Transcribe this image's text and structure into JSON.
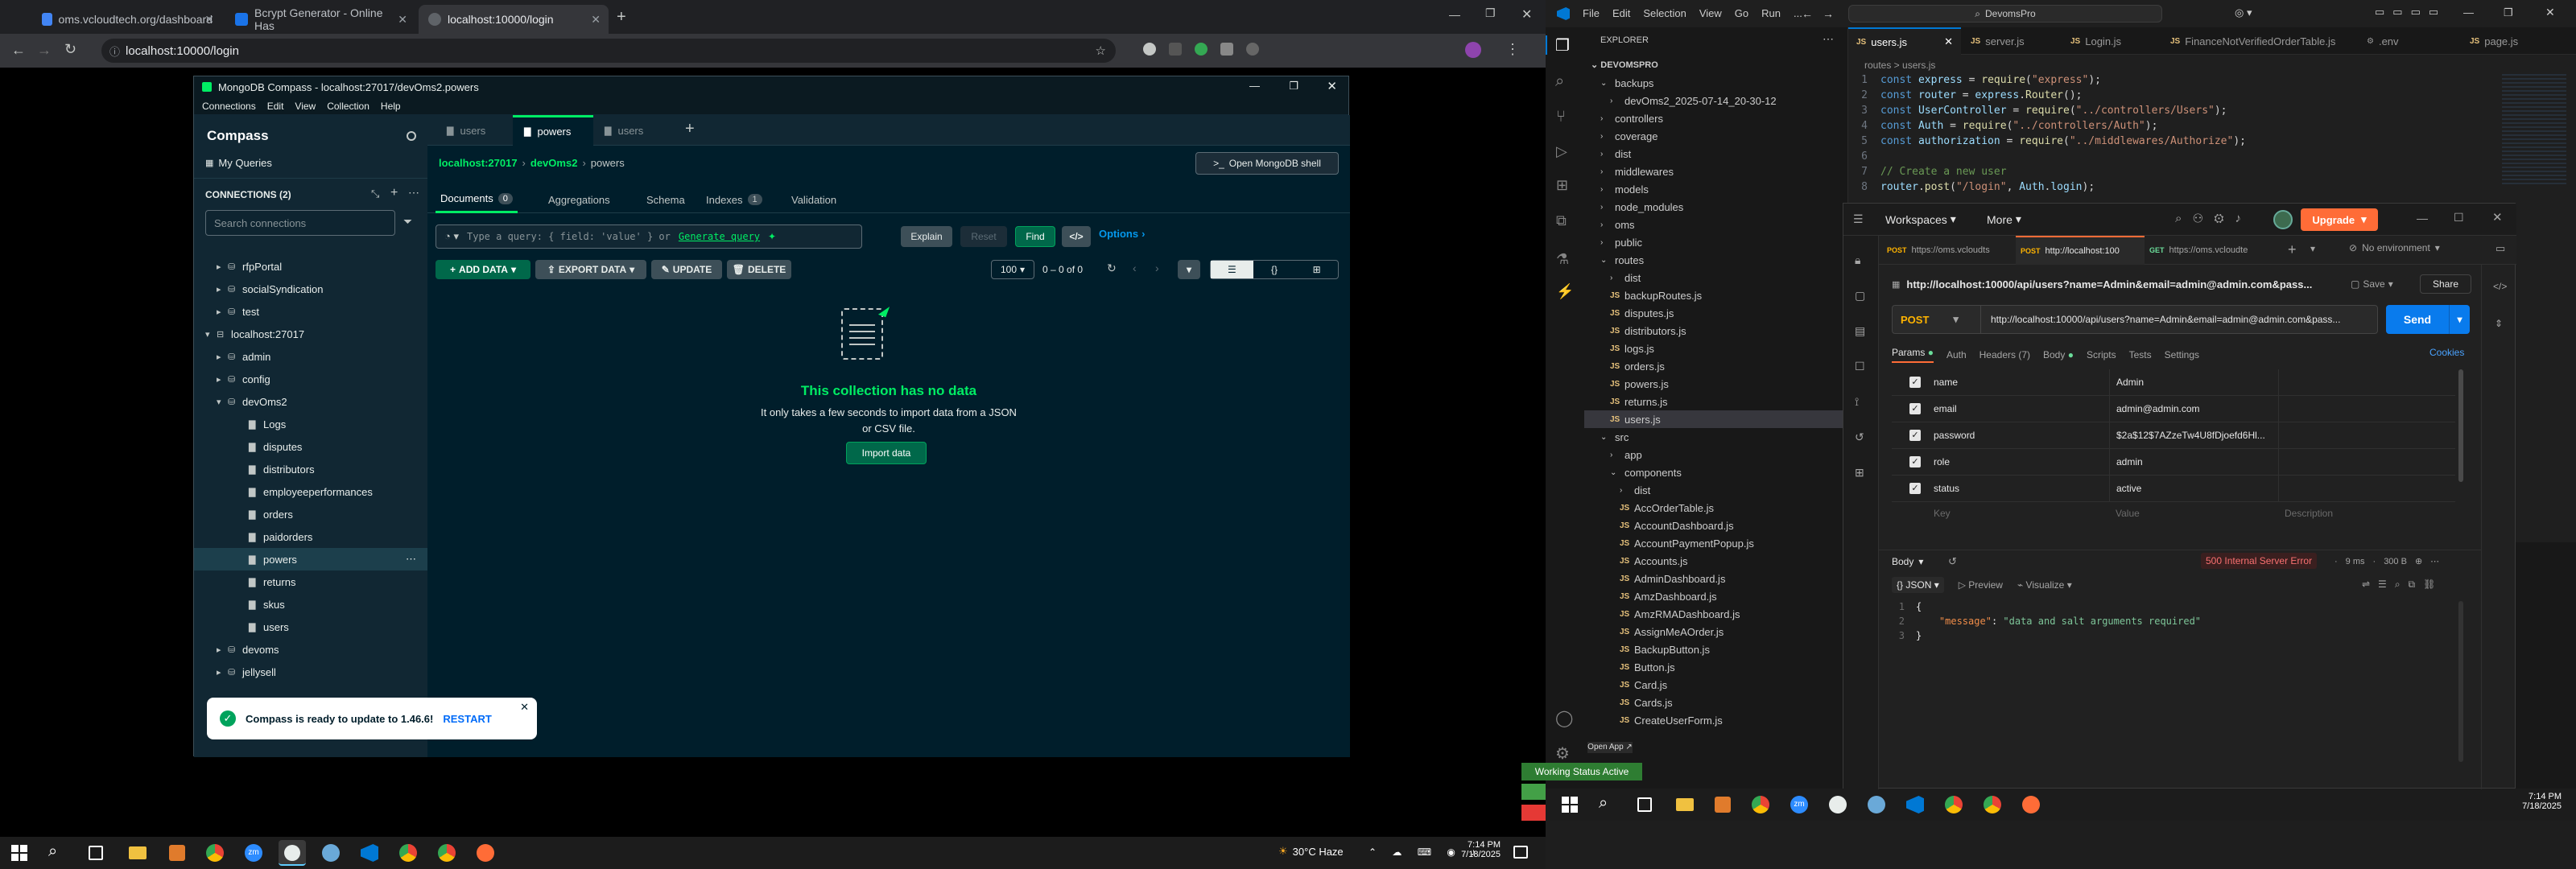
{
  "chrome": {
    "tabs": [
      {
        "title": "oms.vcloudtech.org/dashboard",
        "color": "#4285f4"
      },
      {
        "title": "Bcrypt Generator - Online Has",
        "color": "#1a73e8"
      },
      {
        "title": "localhost:10000/login",
        "color": "#9aa0a6"
      }
    ],
    "url": "localhost:10000/login"
  },
  "compass": {
    "window_title": "MongoDB Compass - localhost:27017/devOms2.powers",
    "menu": [
      "Connections",
      "Edit",
      "View",
      "Collection",
      "Help"
    ],
    "brand": "Compass",
    "my_queries": "My Queries",
    "connections_label": "CONNECTIONS (2)",
    "search_placeholder": "Search connections",
    "tree": [
      {
        "label": "rfpPortal",
        "level": 1,
        "type": "db"
      },
      {
        "label": "socialSyndication",
        "level": 1,
        "type": "db"
      },
      {
        "label": "test",
        "level": 1,
        "type": "db"
      },
      {
        "label": "localhost:27017",
        "level": 0,
        "type": "conn"
      },
      {
        "label": "admin",
        "level": 1,
        "type": "db"
      },
      {
        "label": "config",
        "level": 1,
        "type": "db"
      },
      {
        "label": "devOms2",
        "level": 1,
        "type": "db-open"
      },
      {
        "label": "Logs",
        "level": 2,
        "type": "coll"
      },
      {
        "label": "disputes",
        "level": 2,
        "type": "coll"
      },
      {
        "label": "distributors",
        "level": 2,
        "type": "coll"
      },
      {
        "label": "employeeperformances",
        "level": 2,
        "type": "coll"
      },
      {
        "label": "orders",
        "level": 2,
        "type": "coll"
      },
      {
        "label": "paidorders",
        "level": 2,
        "type": "coll"
      },
      {
        "label": "powers",
        "level": 2,
        "type": "coll-sel"
      },
      {
        "label": "returns",
        "level": 2,
        "type": "coll"
      },
      {
        "label": "skus",
        "level": 2,
        "type": "coll"
      },
      {
        "label": "users",
        "level": 2,
        "type": "coll"
      },
      {
        "label": "devoms",
        "level": 1,
        "type": "db"
      },
      {
        "label": "jellysell",
        "level": 1,
        "type": "db"
      }
    ],
    "tabs": [
      "users",
      "powers",
      "users"
    ],
    "breadcrumb": {
      "host": "localhost:27017",
      "db": "devOms2",
      "coll": "powers"
    },
    "open_shell": "Open MongoDB shell",
    "subtabs": [
      {
        "label": "Documents",
        "badge": "0"
      },
      {
        "label": "Aggregations",
        "badge": ""
      },
      {
        "label": "Schema",
        "badge": ""
      },
      {
        "label": "Indexes",
        "badge": "1"
      },
      {
        "label": "Validation",
        "badge": ""
      }
    ],
    "query_placeholder": "Type a query: { field: 'value' } or",
    "generate_query": "Generate query",
    "explain": "Explain",
    "reset": "Reset",
    "find": "Find",
    "options": "Options",
    "add_data": "ADD DATA",
    "export_data": "EXPORT DATA",
    "update": "UPDATE",
    "delete": "DELETE",
    "page_size": "100",
    "range": "0 – 0 of 0",
    "empty_title": "This collection has no data",
    "empty_desc": "It only takes a few seconds to import data from a JSON or CSV file.",
    "import_data": "Import data",
    "toast_text": "Compass is ready to update to 1.46.6!",
    "toast_action": "RESTART"
  },
  "taskbar_left": {
    "weather": "30°C  Haze",
    "time": "7:14 PM",
    "date": "7/18/2025"
  },
  "vscode": {
    "menu": [
      "File",
      "Edit",
      "Selection",
      "View",
      "Go",
      "Run",
      "..."
    ],
    "search": "DevomsPro",
    "explorer_title": "EXPLORER",
    "project": "DEVOMSPRO",
    "tabs": [
      "users.js",
      "server.js",
      "Login.js",
      "FinanceNotVerifiedOrderTable.js",
      ".env",
      "page.js"
    ],
    "breadcrumb": "routes > users.js",
    "explorer": [
      {
        "label": "backups",
        "indent": 1,
        "kind": "folder-open"
      },
      {
        "label": "devOms2_2025-07-14_20-30-12",
        "indent": 2,
        "kind": "folder"
      },
      {
        "label": "controllers",
        "indent": 1,
        "kind": "folder"
      },
      {
        "label": "coverage",
        "indent": 1,
        "kind": "folder"
      },
      {
        "label": "dist",
        "indent": 1,
        "kind": "folder"
      },
      {
        "label": "middlewares",
        "indent": 1,
        "kind": "folder"
      },
      {
        "label": "models",
        "indent": 1,
        "kind": "folder"
      },
      {
        "label": "node_modules",
        "indent": 1,
        "kind": "folder"
      },
      {
        "label": "oms",
        "indent": 1,
        "kind": "folder"
      },
      {
        "label": "public",
        "indent": 1,
        "kind": "folder"
      },
      {
        "label": "routes",
        "indent": 1,
        "kind": "folder-open"
      },
      {
        "label": "dist",
        "indent": 2,
        "kind": "folder"
      },
      {
        "label": "backupRoutes.js",
        "indent": 2,
        "kind": "js"
      },
      {
        "label": "disputes.js",
        "indent": 2,
        "kind": "js"
      },
      {
        "label": "distributors.js",
        "indent": 2,
        "kind": "js"
      },
      {
        "label": "logs.js",
        "indent": 2,
        "kind": "js"
      },
      {
        "label": "orders.js",
        "indent": 2,
        "kind": "js"
      },
      {
        "label": "powers.js",
        "indent": 2,
        "kind": "js"
      },
      {
        "label": "returns.js",
        "indent": 2,
        "kind": "js"
      },
      {
        "label": "users.js",
        "indent": 2,
        "kind": "js-sel"
      },
      {
        "label": "src",
        "indent": 1,
        "kind": "folder-open"
      },
      {
        "label": "app",
        "indent": 2,
        "kind": "folder"
      },
      {
        "label": "components",
        "indent": 2,
        "kind": "folder-open"
      },
      {
        "label": "dist",
        "indent": 3,
        "kind": "folder"
      },
      {
        "label": "AccOrderTable.js",
        "indent": 3,
        "kind": "js"
      },
      {
        "label": "AccountDashboard.js",
        "indent": 3,
        "kind": "js"
      },
      {
        "label": "AccountPaymentPopup.js",
        "indent": 3,
        "kind": "js"
      },
      {
        "label": "Accounts.js",
        "indent": 3,
        "kind": "js"
      },
      {
        "label": "AdminDashboard.js",
        "indent": 3,
        "kind": "js"
      },
      {
        "label": "AmzDashboard.js",
        "indent": 3,
        "kind": "js"
      },
      {
        "label": "AmzRMADashboard.js",
        "indent": 3,
        "kind": "js"
      },
      {
        "label": "AssignMeAOrder.js",
        "indent": 3,
        "kind": "js"
      },
      {
        "label": "BackupButton.js",
        "indent": 3,
        "kind": "js"
      },
      {
        "label": "Button.js",
        "indent": 3,
        "kind": "js"
      },
      {
        "label": "Card.js",
        "indent": 3,
        "kind": "js"
      },
      {
        "label": "Cards.js",
        "indent": 3,
        "kind": "js"
      },
      {
        "label": "CreateUserForm.js",
        "indent": 3,
        "kind": "js"
      }
    ],
    "code": [
      {
        "n": "1",
        "t": "const express = require(\"express\");"
      },
      {
        "n": "2",
        "t": "const router = express.Router();"
      },
      {
        "n": "3",
        "t": "const UserController = require(\"../controllers/Users\");"
      },
      {
        "n": "4",
        "t": "const Auth = require(\"../controllers/Auth\");"
      },
      {
        "n": "5",
        "t": "const authorization = require(\"../middlewares/Authorize\");"
      },
      {
        "n": "6",
        "t": ""
      },
      {
        "n": "7",
        "t": "// Create a new user"
      },
      {
        "n": "8",
        "t": "router.post(\"/login\", Auth.login);"
      }
    ],
    "status_badge": "Working Status Active",
    "open_app": "Open App ↗"
  },
  "postman": {
    "workspaces": "Workspaces",
    "more": "More",
    "upgrade": "Upgrade",
    "tabs": [
      {
        "method": "POST",
        "label": "https://oms.vcloudts"
      },
      {
        "method": "POST",
        "label": "http://localhost:100"
      },
      {
        "method": "GET",
        "label": "https://oms.vcloudte"
      }
    ],
    "environment": "No environment",
    "request_name": "http://localhost:10000/api/users?name=Admin&email=admin@admin.com&pass...",
    "save": "Save",
    "share": "Share",
    "method": "POST",
    "url": "http://localhost:10000/api/users?name=Admin&email=admin@admin.com&pass...",
    "send": "Send",
    "req_tabs": [
      "Params",
      "Auth",
      "Headers (7)",
      "Body",
      "Scripts",
      "Tests",
      "Settings"
    ],
    "cookies": "Cookies",
    "params": [
      {
        "key": "name",
        "value": "Admin"
      },
      {
        "key": "email",
        "value": "admin@admin.com"
      },
      {
        "key": "password",
        "value": "$2a$12$7AZzeTw4U8fDjoefd6Hl..."
      },
      {
        "key": "role",
        "value": "admin"
      },
      {
        "key": "status",
        "value": "active"
      }
    ],
    "param_placeholders": {
      "key": "Key",
      "value": "Value",
      "desc": "Description"
    },
    "resp_label": "Body",
    "status": "500 Internal Server Error",
    "time": "9 ms",
    "size": "300 B",
    "format": "JSON",
    "preview": "Preview",
    "visualize": "Visualize",
    "resp_lines": [
      {
        "n": "1",
        "t": "{"
      },
      {
        "n": "2",
        "t": "    \"message\": \"data and salt arguments required\""
      },
      {
        "n": "3",
        "t": "}"
      }
    ]
  },
  "taskbar_right": {
    "time": "7:14 PM",
    "date": "7/18/2025"
  }
}
